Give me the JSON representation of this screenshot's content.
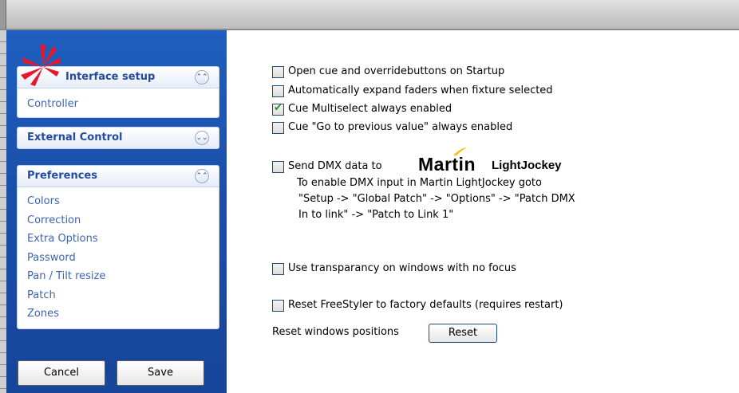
{
  "sidebar": {
    "panels": [
      {
        "title": "Interface setup",
        "expanded": true,
        "items": [
          "Controller"
        ]
      },
      {
        "title": "External Control",
        "expanded": false,
        "items": []
      },
      {
        "title": "Preferences",
        "expanded": true,
        "items": [
          "Colors",
          "Correction",
          "Extra Options",
          "Password",
          "Pan / Tilt resize",
          "Patch",
          "Zones"
        ]
      }
    ],
    "cancel_label": "Cancel",
    "save_label": "Save"
  },
  "options": [
    {
      "label": "Open cue and overridebuttons on Startup",
      "checked": false
    },
    {
      "label": "Automatically expand faders when fixture selected",
      "checked": false
    },
    {
      "label": "Cue Multiselect always enabled",
      "checked": true
    },
    {
      "label": "Cue \"Go to previous value\" always enabled",
      "checked": false
    }
  ],
  "dmx": {
    "label": "Send DMX data to",
    "checked": false,
    "brand": "Martin",
    "product": "LightJockey",
    "note": [
      "To enable DMX input in Martin LightJockey goto",
      "\"Setup -> \"Global Patch\" -> \"Options\" -> \"Patch DMX",
      "In to link\" -> \"Patch to Link 1\""
    ]
  },
  "transparency": {
    "label": "Use transparancy on windows with no focus",
    "checked": false
  },
  "factory": {
    "label": "Reset FreeStyler to factory defaults (requires restart)",
    "checked": false
  },
  "reset_windows": {
    "label": "Reset windows positions",
    "button": "Reset"
  },
  "colors": {
    "sidebar": "#1a4fa8",
    "header_text": "#234b9f",
    "item_text": "#3c64b0",
    "logo": "#e8182c"
  }
}
